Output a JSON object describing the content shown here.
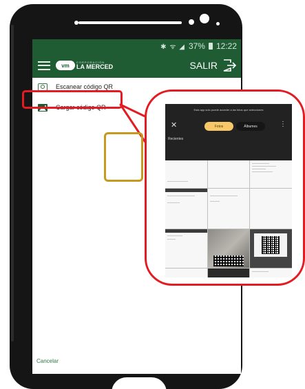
{
  "status_bar": {
    "icons": "✱ ᯤ ◢",
    "battery": "37%",
    "time": "12:22"
  },
  "toolbar": {
    "logo_mark": "vm",
    "logo_small": "CORPORACIÓN",
    "logo_name": "LA MERCED",
    "logout_label": "SALIR"
  },
  "menu": {
    "items": [
      {
        "label": "Escanear código QR",
        "icon": "camera-icon"
      },
      {
        "label": "Cargar código QR",
        "icon": "image-icon"
      }
    ],
    "cancel_label": "Cancelar"
  },
  "picker": {
    "message": "Esta app solo puede acceder a las fotos que selecciones",
    "tabs": [
      "Fotos",
      "Álbumes"
    ],
    "section": "Recientes",
    "close_glyph": "✕",
    "more_glyph": "⋮"
  },
  "colors": {
    "brand_green": "#1f5c33",
    "highlight_red": "#e31b23",
    "selection_gold": "#c79a1f",
    "tab_active": "#f6c86a"
  }
}
